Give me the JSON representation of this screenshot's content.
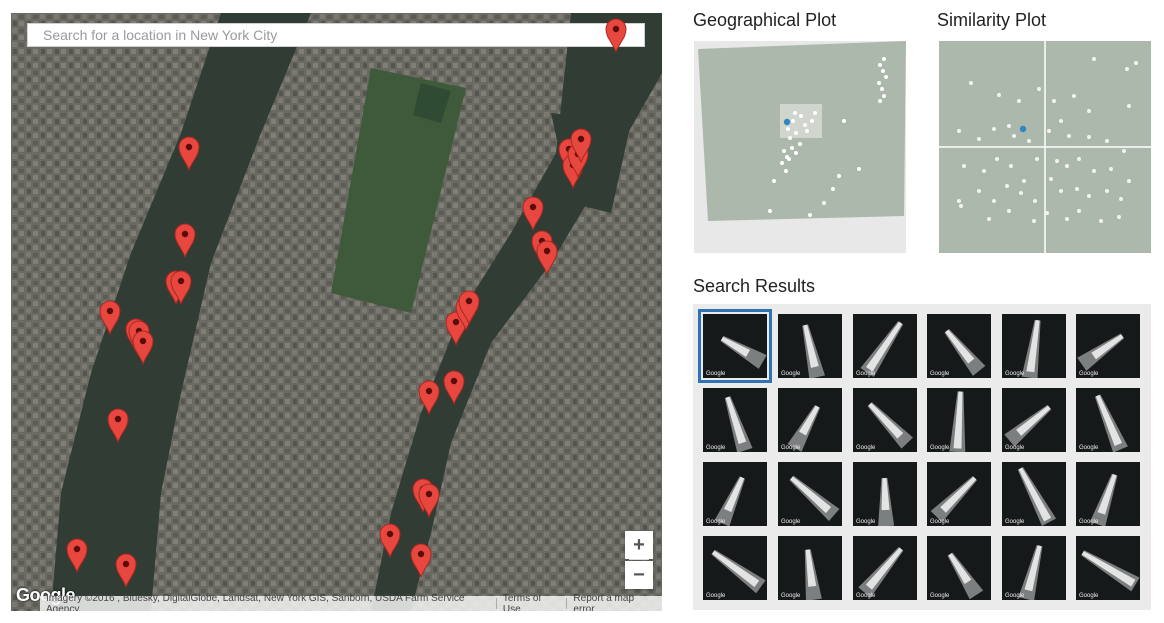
{
  "map": {
    "search_placeholder": "Search for a location in New York City",
    "zoom_in_label": "+",
    "zoom_out_label": "−",
    "google_logo_text": "Google",
    "attribution": "Imagery ©2016 , Bluesky, DigitalGlobe, Landsat, New York GIS, Sanborn, USDA Farm Service Agency",
    "terms_link": "Terms of Use",
    "report_link": "Report a map error",
    "pin_color": "#e8473f",
    "water_color": "#2f3a33",
    "land_color": "#6b6b64",
    "park_color": "#3e5a3a"
  },
  "geo_plot": {
    "title": "Geographical Plot",
    "background_color": "#adb8ad",
    "selected_point_color": "#2e86c1",
    "selection_color": "#d8dcd6"
  },
  "similarity_plot": {
    "title": "Similarity Plot",
    "background_color": "#adb8ad",
    "selected_point_color": "#2e86c1"
  },
  "search_results": {
    "title": "Search Results",
    "thumbnail_label": "Google",
    "selected_border_color": "#2e74b5",
    "rows": 4,
    "columns": 6,
    "selected_index": 0
  }
}
